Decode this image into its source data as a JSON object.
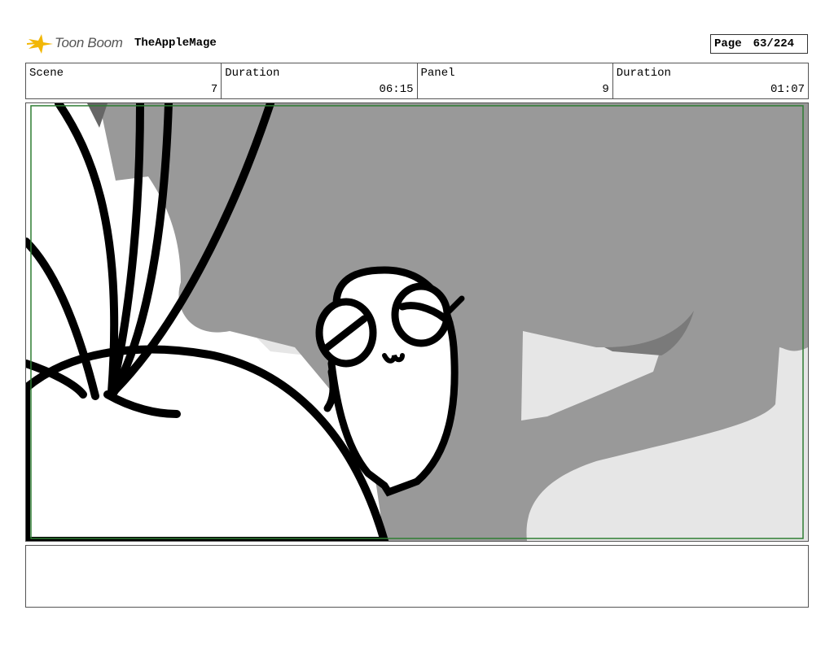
{
  "header": {
    "logo_text": "Toon Boom",
    "project_title": "TheAppleMage",
    "page_label": "Page",
    "page_value": "63/224"
  },
  "info": {
    "scene_label": "Scene",
    "scene_value": "7",
    "scene_duration_label": "Duration",
    "scene_duration_value": "06:15",
    "panel_label": "Panel",
    "panel_value": "9",
    "panel_duration_label": "Duration",
    "panel_duration_value": "01:07"
  },
  "colors": {
    "safe_frame": "#2e7d32",
    "tree_gray": "#999999",
    "light_gray": "#e6e6e6",
    "dark_gray": "#7a7a7a"
  },
  "icons": {
    "logo": "toon-boom-star-icon"
  },
  "notes": {
    "text": ""
  }
}
